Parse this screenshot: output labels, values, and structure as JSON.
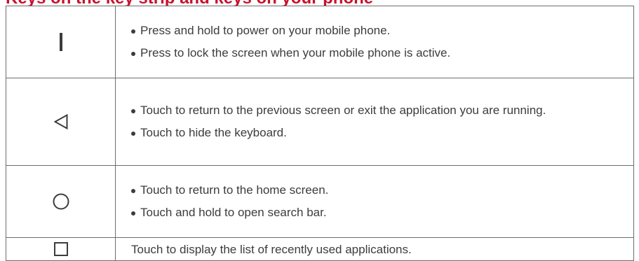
{
  "page": {
    "heading": "Keys on the key strip and keys on your phone"
  },
  "keys": [
    {
      "icon": "power-key-icon",
      "items": [
        "Press and hold to power on your mobile phone.",
        "Press to lock the screen when your mobile phone is active."
      ]
    },
    {
      "icon": "back-key-icon",
      "items": [
        "Touch to return to the previous screen or exit the application you are running.",
        "Touch to hide the keyboard."
      ]
    },
    {
      "icon": "home-key-icon",
      "items": [
        "Touch to return to the home screen.",
        "Touch and hold to open search bar."
      ]
    },
    {
      "icon": "recent-apps-key-icon",
      "text": "Touch to display the list of recently used applications."
    }
  ],
  "colors": {
    "heading": "#c8102e",
    "text": "#3c3c3c",
    "border": "#6d6d6d"
  }
}
